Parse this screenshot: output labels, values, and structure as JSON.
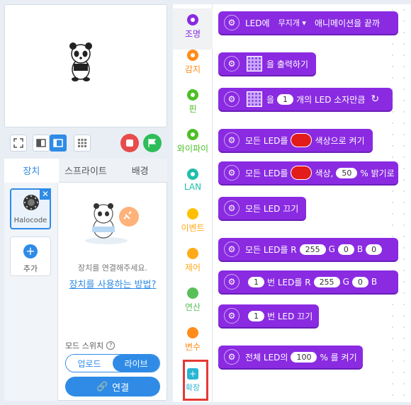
{
  "left_tabs": [
    "장치",
    "스프라이트",
    "배경"
  ],
  "device": {
    "name": "Halocode",
    "add_label": "추가"
  },
  "connect_hint": "장치를 연결해주세요.",
  "howto_link": "장치를 사용하는 방법?",
  "mode": {
    "label": "모드 스위치",
    "upload": "업로드",
    "live": "라이브",
    "connect": "연결"
  },
  "categories": [
    {
      "label": "조명",
      "color": "#8a2be2",
      "active": true
    },
    {
      "label": "감지",
      "color": "#ff8c1a"
    },
    {
      "label": "핀",
      "color": "#4cbf26"
    },
    {
      "label": "와이파이",
      "color": "#4cbf26"
    },
    {
      "label": "LAN",
      "color": "#1fbfa9"
    },
    {
      "label": "이벤트",
      "color": "#ffbf00"
    },
    {
      "label": "제어",
      "color": "#ffab19"
    },
    {
      "label": "연산",
      "color": "#59c059"
    },
    {
      "label": "변수",
      "color": "#ff8c1a"
    },
    {
      "label": "확장",
      "color": "#29b6d3"
    }
  ],
  "blocks": {
    "b1": {
      "a": "LED에",
      "b": "무지개 ▾",
      "c": "애니메이션을 끝까"
    },
    "b2": {
      "a": "을 출력하기"
    },
    "b3": {
      "a": "을",
      "n": "1",
      "b": "개의 LED 소자만큼"
    },
    "b4": {
      "a": "모든 LED를",
      "b": "색상으로 켜기"
    },
    "b5": {
      "a": "모든 LED를",
      "b": "색상,",
      "n": "50",
      "c": "% 밝기로"
    },
    "b6": {
      "a": "모든 LED 끄기"
    },
    "b7": {
      "a": "모든 LED를 R",
      "r": "255",
      "g": "G",
      "gv": "0",
      "bl": "B",
      "bv": "0"
    },
    "b8": {
      "n": "1",
      "a": "번 LED를 R",
      "r": "255",
      "g": "G",
      "gv": "0",
      "bl": "B"
    },
    "b9": {
      "n": "1",
      "a": "번 LED 끄기"
    },
    "b10": {
      "a": "전체 LED의",
      "n": "100",
      "b": "% 를 켜기"
    }
  },
  "colors": {
    "accent": "#2f8be6",
    "block": "#8a2be2",
    "stop": "#e84b4b",
    "go": "#2ebd59",
    "highlight": "#e53935"
  }
}
